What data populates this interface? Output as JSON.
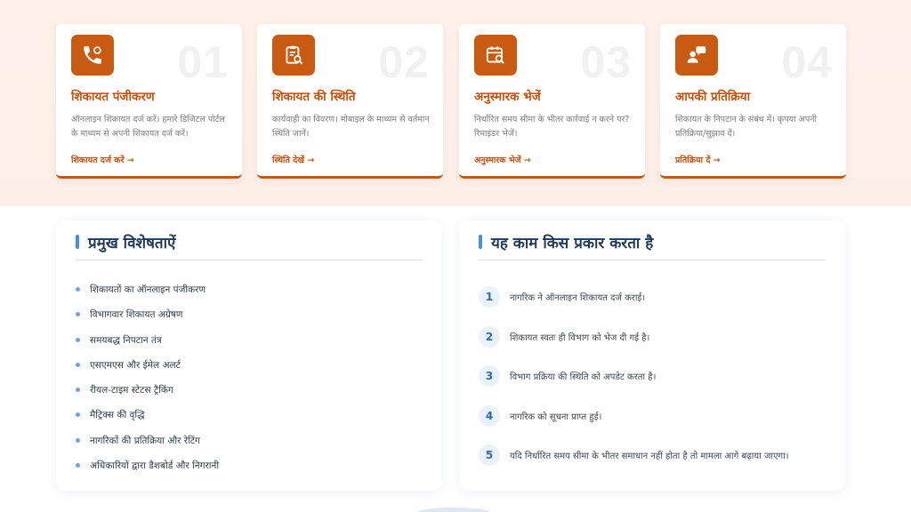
{
  "cards": [
    {
      "num": "01",
      "icon": "phone-icon",
      "title": "शिकायत पंजीकरण",
      "desc": "ऑनलाइन शिकायत दर्ज करें। हमारे डिजिटल पोर्टल के माध्यम से अपनी शिकायत दर्ज करें।",
      "link": "शिकायत दर्ज करें →"
    },
    {
      "num": "02",
      "icon": "clipboard-search-icon",
      "title": "शिकायत की स्थिति",
      "desc": "कार्यवाही का विवरण। मोबाइल के माध्यम से वर्तमान स्थिति जानें।",
      "link": "स्थिति देखें →"
    },
    {
      "num": "03",
      "icon": "calendar-search-icon",
      "title": "अनुस्मारक भेजें",
      "desc": "निर्धारित समय सीमा के भीतर कार्रवाई न करने पर? रिमाइंडर भेजें।",
      "link": "अनुस्मारक भेजें →"
    },
    {
      "num": "04",
      "icon": "feedback-user-icon",
      "title": "आपकी प्रतिक्रिया",
      "desc": "शिकायत के निपटान के संबंध में। कृपया अपनी प्रतिक्रिया/सुझाव दें।",
      "link": "प्रतिक्रिया दें →"
    }
  ],
  "features": {
    "title": "प्रमुख विशेषताऐं",
    "items": [
      "शिकायतों का ऑनलाइन पंजीकरण",
      "विभागवार शिकायत अग्रेषण",
      "समयबद्ध निपटान तंत्र",
      "एसएमएस और ईमेल अलर्ट",
      "रीयल-टाइम स्टेटस ट्रैकिंग",
      "मैट्रिक्स की वृद्धि",
      "नागरिकों की प्रतिक्रिया और रेटिंग",
      "अधिकारियों द्वारा डैशबोर्ड और निगरानी"
    ]
  },
  "how_it_works": {
    "title": "यह काम किस प्रकार करता है",
    "steps": [
      {
        "n": "1",
        "text": "नागरिक ने ऑनलाइन शिकायत दर्ज कराई।"
      },
      {
        "n": "2",
        "text": "शिकायत स्वतः ही विभाग को भेज दी गई है।"
      },
      {
        "n": "3",
        "text": "विभाग प्रक्रिया की स्थिति को अपडेट करता है।"
      },
      {
        "n": "4",
        "text": "नागरिक को सूचना प्राप्त हुई।"
      },
      {
        "n": "5",
        "text": "यदि निर्धारित समय सीमा के भीतर समाधान नहीं होता है तो मामला आगे बढ़ाया जाएगा।"
      }
    ]
  },
  "colors": {
    "accent": "#c95a12",
    "heading": "#1f3a5a",
    "blue": "#4a90d9"
  }
}
